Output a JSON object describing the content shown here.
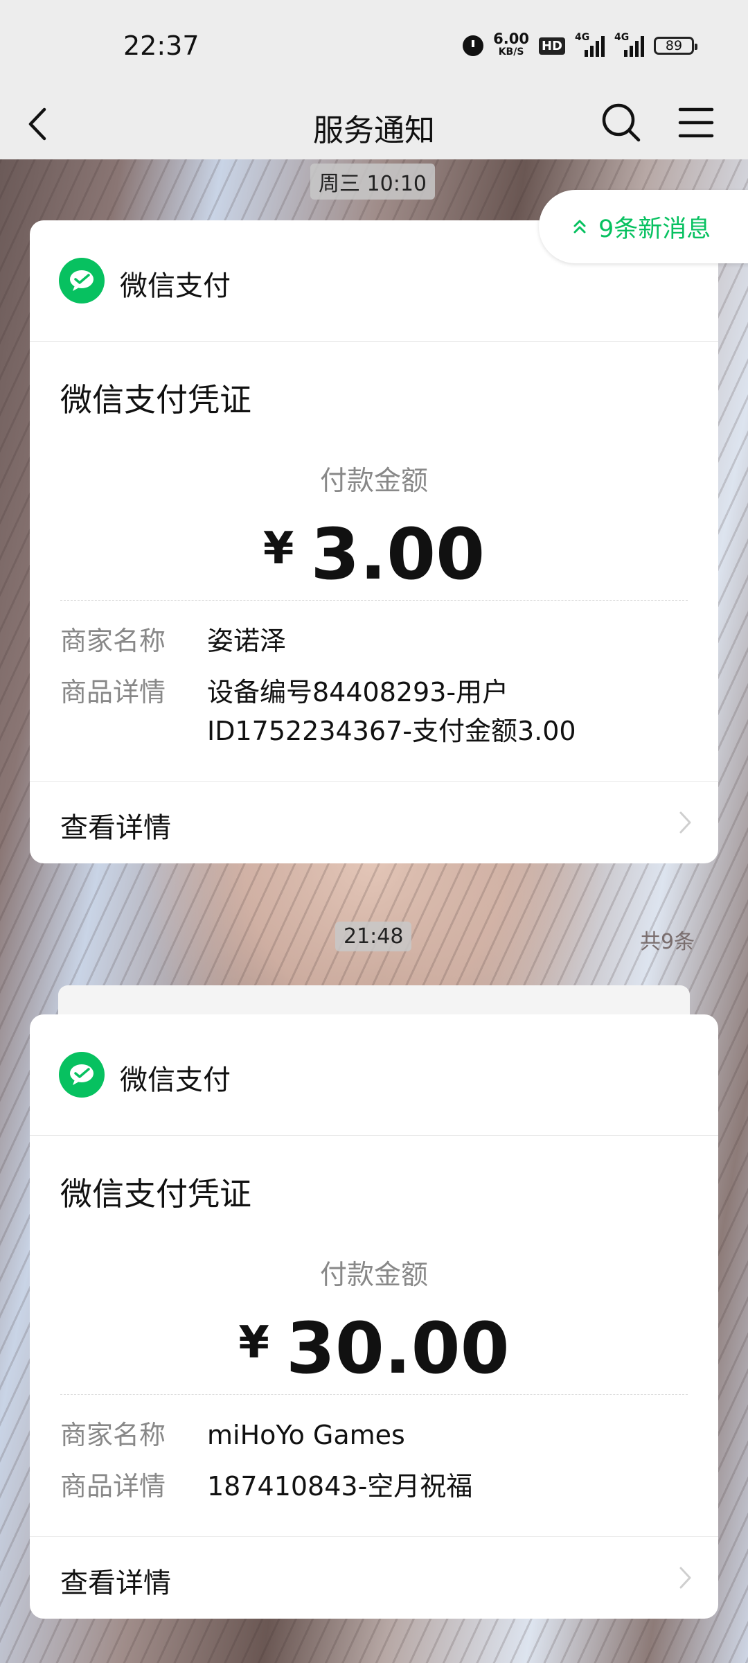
{
  "status_bar": {
    "time": "22:37",
    "net_speed_value": "6.00",
    "net_speed_unit": "KB/S",
    "hd_label": "HD",
    "signal1_label": "4G",
    "signal2_label": "4G",
    "battery": "89",
    "icons": [
      "alarm-icon",
      "hd-icon",
      "signal-icon",
      "signal-icon",
      "battery-icon"
    ]
  },
  "nav": {
    "title": "服务通知",
    "icons": [
      "back-icon",
      "search-icon",
      "menu-icon"
    ]
  },
  "new_messages_label": "9条新消息",
  "total_count": "共9条",
  "accent_color": "#07c160",
  "messages": [
    {
      "timestamp": "周三 10:10",
      "brand": "微信支付",
      "voucher_title": "微信支付凭证",
      "amount_label": "付款金额",
      "currency": "¥",
      "amount": "3.00",
      "merchant_key": "商家名称",
      "merchant_value": "姿诺泽",
      "detail_key": "商品详情",
      "detail_value_line1": "设备编号84408293-用户",
      "detail_value_line2": "ID1752234367-支付金额3.00",
      "more_label": "查看详情"
    },
    {
      "timestamp": "21:48",
      "brand": "微信支付",
      "voucher_title": "微信支付凭证",
      "amount_label": "付款金额",
      "currency": "¥",
      "amount": "30.00",
      "merchant_key": "商家名称",
      "merchant_value": "miHoYo Games",
      "detail_key": "商品详情",
      "detail_value_line1": "187410843-空月祝福",
      "more_label": "查看详情"
    }
  ]
}
